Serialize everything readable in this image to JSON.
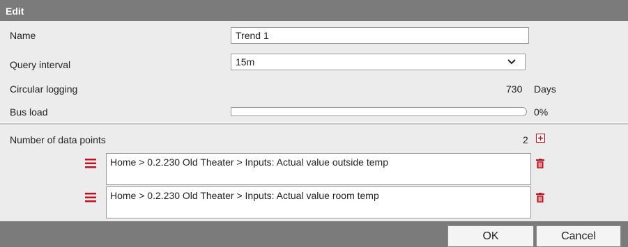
{
  "dialog": {
    "title": "Edit"
  },
  "fields": {
    "name": {
      "label": "Name",
      "value": "Trend 1"
    },
    "query_interval": {
      "label": "Query interval",
      "value": "15m"
    },
    "circular_logging": {
      "label": "Circular logging",
      "value": "730",
      "unit": "Days"
    },
    "bus_load": {
      "label": "Bus load",
      "value_text": "0%",
      "fraction": 0
    }
  },
  "data_points": {
    "label": "Number of data points",
    "count": "2",
    "items": [
      {
        "path": "Home > 0.2.230 Old Theater > Inputs: Actual value outside temp"
      },
      {
        "path": "Home > 0.2.230 Old Theater > Inputs: Actual value room temp"
      }
    ]
  },
  "footer": {
    "ok_label": "OK",
    "cancel_label": "Cancel"
  },
  "colors": {
    "accent_red": "#c0121d",
    "header_gray": "#7b7b7b",
    "row_gray": "#ececec"
  },
  "icons": {
    "drag": "drag-handle-icon",
    "delete": "trash-icon",
    "add": "plus-box-icon",
    "dropdown": "chevron-down-icon"
  }
}
